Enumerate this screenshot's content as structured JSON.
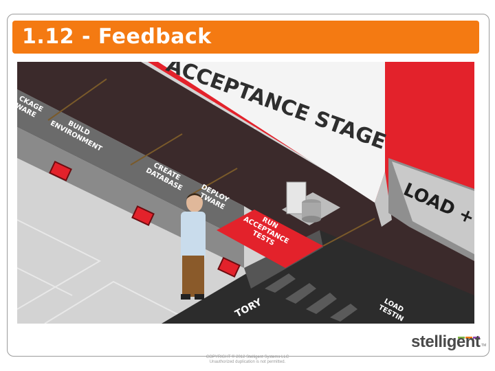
{
  "slide": {
    "title": "1.12 - Feedback",
    "accent_color": "#f47a12"
  },
  "scene": {
    "stage_banner": "ACCEPTANCE STAGE",
    "load_banner": "LOAD + P",
    "steps": {
      "package": [
        "CKAGE",
        "WARE"
      ],
      "build": [
        "BUILD",
        "ENVIRONMENT"
      ],
      "create": [
        "CREATE",
        "DATABASE"
      ],
      "deploy": [
        "DEPLOY",
        "TWARE"
      ],
      "run": [
        "RUN",
        "ACCEPTANCE",
        "TESTS"
      ],
      "history": "TORY",
      "load": [
        "LOAD",
        "TESTIN"
      ]
    },
    "colors": {
      "red": "#e3222b",
      "dark_belt": "#3a2a2b",
      "floor": "#d3d3d3"
    }
  },
  "footer": {
    "logo_text": "stelligent",
    "logo_tm": "TM",
    "logo_bar_colors": [
      "#7cb342",
      "#f47a12",
      "#8e44ad"
    ],
    "copyright_line1": "COPYRIGHT © 2012 Stelligent Systems LLC",
    "copyright_line2": "Unauthorized duplication is not permitted."
  }
}
